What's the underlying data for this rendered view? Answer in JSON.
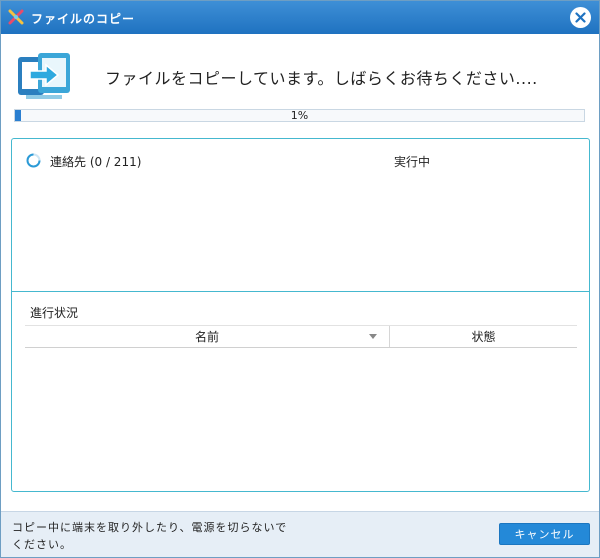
{
  "window": {
    "title": "ファイルのコピー",
    "app_icon": "app-logo-icon",
    "close_icon": "close-icon"
  },
  "header": {
    "icon": "file-transfer-icon",
    "message": "ファイルをコピーしています。しばらくお待ちください...."
  },
  "progress": {
    "percent": 1,
    "label": "1%"
  },
  "task": {
    "icon": "spinner-icon",
    "label": "連絡先 (0 / 211)",
    "status": "実行中"
  },
  "details": {
    "section_title": "進行状況",
    "columns": [
      "名前",
      "状態"
    ],
    "rows": []
  },
  "footer": {
    "note_line1": "コピー中に端末を取り外したり、電源を切らないで",
    "note_line2": "ください。",
    "cancel_label": "キャンセル"
  },
  "colors": {
    "titlebar": "#2b80cb",
    "accent": "#2489d8",
    "panel_border": "#45b8cf",
    "footer_bg": "#e6eef6"
  }
}
